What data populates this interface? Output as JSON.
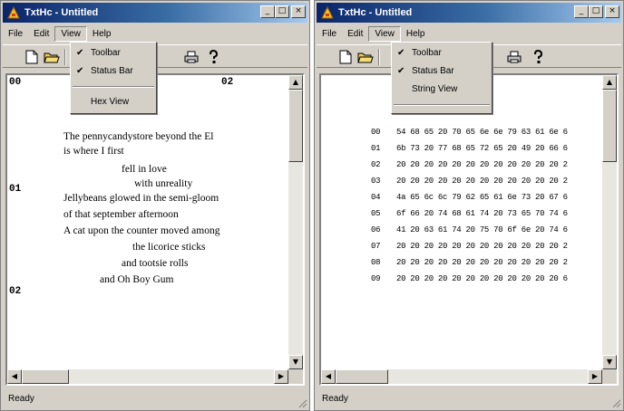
{
  "windows": [
    {
      "title": "TxtHc - Untitled",
      "menu": [
        "File",
        "Edit",
        "View",
        "Help"
      ],
      "status": "Ready",
      "view_menu": [
        {
          "label": "Toolbar",
          "checked": true
        },
        {
          "label": "Status Bar",
          "checked": true
        },
        {
          "label": "Hex View",
          "checked": false
        }
      ],
      "text_view": {
        "addresses": [
          "00",
          "01",
          "02"
        ],
        "top_label": "02",
        "lines": [
          "The pennycandystore beyond the El",
          "is where I first",
          "fell in love",
          "with unreality",
          "Jellybeans glowed in the semi-gloom",
          "of that september afternoon",
          "A cat upon the counter moved among",
          "the licorice sticks",
          "and tootsie rolls",
          "and Oh Boy Gum"
        ]
      }
    },
    {
      "title": "TxtHc - Untitled",
      "menu": [
        "File",
        "Edit",
        "View",
        "Help"
      ],
      "status": "Ready",
      "view_menu": [
        {
          "label": "Toolbar",
          "checked": true
        },
        {
          "label": "Status Bar",
          "checked": true
        },
        {
          "label": "String View",
          "checked": false
        }
      ],
      "hex_view": {
        "rows": [
          {
            "addr": "00",
            "bytes": "54 68 65 20 70 65 6e 6e 79 63 61 6e 6"
          },
          {
            "addr": "01",
            "bytes": "6b 73 20 77 68 65 72 65 20 49 20 66 6"
          },
          {
            "addr": "02",
            "bytes": "20 20 20 20 20 20 20 20 20 20 20 20 2"
          },
          {
            "addr": "03",
            "bytes": "20 20 20 20 20 20 20 20 20 20 20 20 2"
          },
          {
            "addr": "04",
            "bytes": "4a 65 6c 6c 79 62 65 61 6e 73 20 67 6"
          },
          {
            "addr": "05",
            "bytes": "6f 66 20 74 68 61 74 20 73 65 70 74 6"
          },
          {
            "addr": "06",
            "bytes": "41 20 63 61 74 20 75 70 6f 6e 20 74 6"
          },
          {
            "addr": "07",
            "bytes": "20 20 20 20 20 20 20 20 20 20 20 20 2"
          },
          {
            "addr": "08",
            "bytes": "20 20 20 20 20 20 20 20 20 20 20 20 2"
          },
          {
            "addr": "09",
            "bytes": "20 20 20 20 20 20 20 20 20 20 20 20 6"
          }
        ]
      }
    }
  ]
}
